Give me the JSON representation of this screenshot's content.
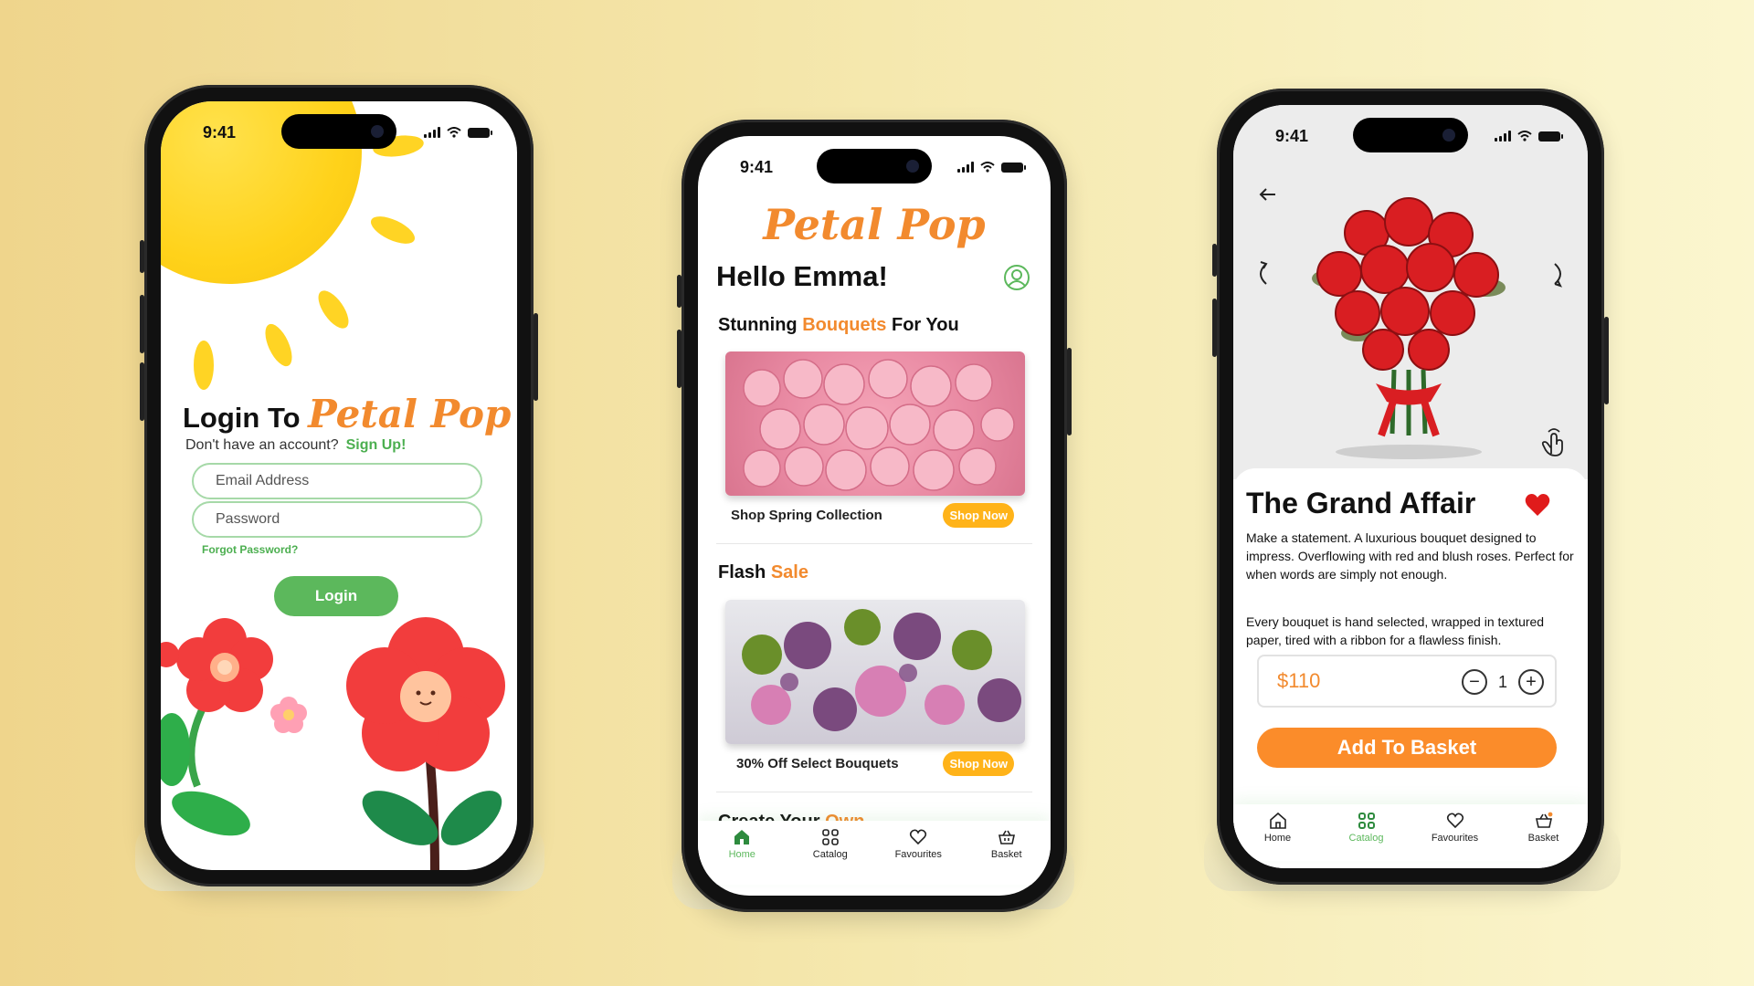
{
  "colors": {
    "accent_orange": "#f28a2e",
    "brand_green": "#5cb85c",
    "shop_yellow": "#ffb319",
    "heart_red": "#e01b1b"
  },
  "status_bar": {
    "time": "9:41"
  },
  "login_screen": {
    "title": "Login To",
    "brand": "Petal Pop",
    "no_account": "Don't have an account?",
    "sign_up": "Sign Up!",
    "email_placeholder": "Email Address",
    "password_placeholder": "Password",
    "forgot": "Forgot Password?",
    "login_button": "Login"
  },
  "home_screen": {
    "brand": "Petal Pop",
    "greeting": "Hello Emma!",
    "section1": {
      "pre": "Stunning",
      "accent": "Bouquets",
      "post": "For You"
    },
    "card1": {
      "label": "Shop Spring Collection",
      "button": "Shop Now"
    },
    "section2": {
      "pre": "Flash",
      "accent": "Sale"
    },
    "card2": {
      "label": "30% Off Select Bouquets",
      "button": "Shop Now"
    },
    "section3": {
      "pre": "Create Your",
      "accent": "Own"
    }
  },
  "tabs": [
    {
      "label": "Home",
      "icon": "home-icon"
    },
    {
      "label": "Catalog",
      "icon": "grid-icon"
    },
    {
      "label": "Favourites",
      "icon": "heart-icon"
    },
    {
      "label": "Basket",
      "icon": "basket-icon"
    }
  ],
  "home_active_tab": "Home",
  "product_active_tab": "Catalog",
  "product_screen": {
    "name": "The Grand Affair",
    "desc1": "Make a statement. A luxurious bouquet designed to impress. Overflowing with red and blush roses. Perfect for when words are simply not enough.",
    "desc2": "Every bouquet is hand selected, wrapped in textured paper, tired with a ribbon for a flawless finish.",
    "price": "$110",
    "quantity": "1",
    "minus": "−",
    "plus": "+",
    "add_button": "Add To Basket"
  }
}
